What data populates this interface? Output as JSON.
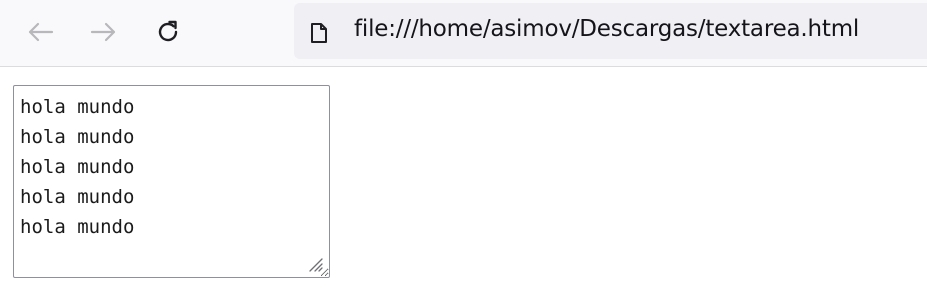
{
  "browser": {
    "url": "file:///home/asimov/Descargas/textarea.html",
    "icons": {
      "back": "arrow-left-icon",
      "forward": "arrow-right-icon",
      "reload": "reload-icon",
      "page": "page-icon"
    }
  },
  "page": {
    "textarea": {
      "value": "hola mundo\nhola mundo\nhola mundo\nhola mundo\nhola mundo"
    }
  }
}
